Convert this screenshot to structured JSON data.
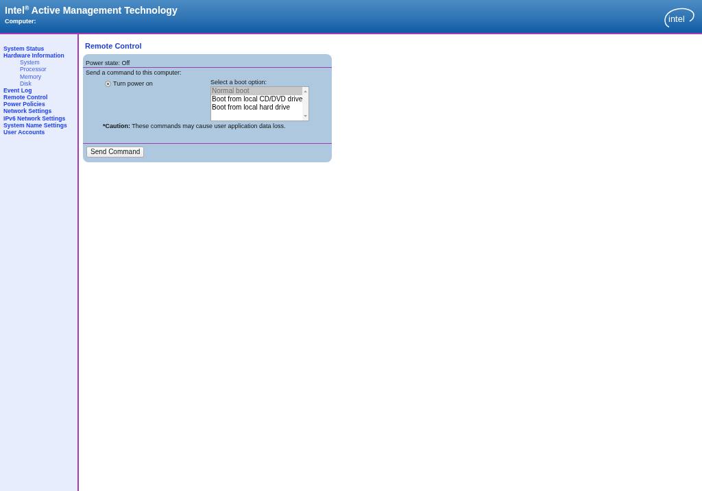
{
  "header": {
    "title": "Intel$^{®}$ Active Management Technology",
    "computer_label": "Computer:",
    "logo": "intel"
  },
  "sidebar": {
    "items": [
      {
        "label": "System Status"
      },
      {
        "label": "Hardware Information",
        "children": [
          {
            "label": "System"
          },
          {
            "label": "Processor"
          },
          {
            "label": "Memory"
          },
          {
            "label": "Disk"
          }
        ]
      },
      {
        "label": "Event Log"
      },
      {
        "label": "Remote Control"
      },
      {
        "label": "Power Policies"
      },
      {
        "label": "Network Settings"
      },
      {
        "label": "IPv6 Network Settings"
      },
      {
        "label": "System Name Settings"
      },
      {
        "label": "User Accounts"
      }
    ]
  },
  "page_title": "Remote Control",
  "panel": {
    "power_state": "Power state: Off",
    "command_prompt": "Send a command to this computer:",
    "commands": [
      {
        "label": "Turn power on",
        "selected": true
      }
    ],
    "boot_option": {
      "label": "Select a boot option:",
      "options": [
        {
          "label": "Normal boot",
          "selected": true
        },
        {
          "label": "Boot from local CD/DVD drive",
          "selected": false
        },
        {
          "label": "Boot from local hard drive",
          "selected": false
        }
      ]
    },
    "caution": {
      "label": "*Caution:",
      "text": "These commands may cause user application data loss."
    },
    "buttons": [
      "Send Command"
    ]
  }
}
